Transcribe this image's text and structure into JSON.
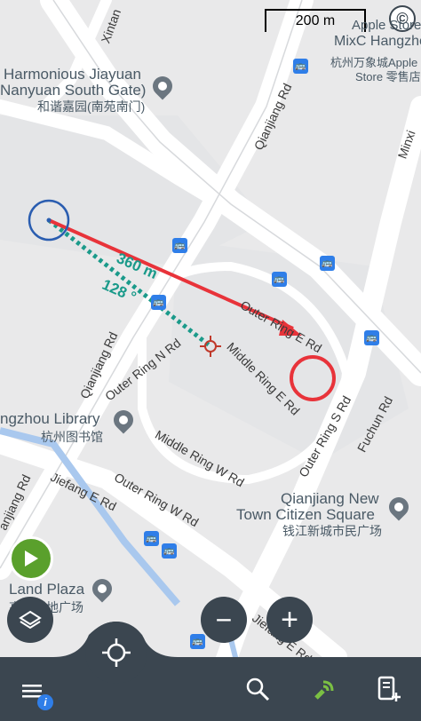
{
  "scale": {
    "label": "200 m"
  },
  "copyright_icon": "copyright-icon",
  "measurement": {
    "distance": "360 m",
    "bearing": "128 °"
  },
  "pois": {
    "apple_store": {
      "line1": "Apple Store, th",
      "line2": "MixC Hangzhou",
      "line3": "杭州万象城Apple",
      "line4": "Store 零售店"
    },
    "harmonious": {
      "line1": "Harmonious Jiayuan",
      "line2": "Nanyuan South Gate)",
      "line3": "和谐嘉园(南苑南门)"
    },
    "library": {
      "line1": "ngzhou Library",
      "line2": "杭州图书馆"
    },
    "citizen_square": {
      "line1": "Qianjiang New",
      "line2": "Town Citizen Square",
      "line3": "钱江新城市民广场"
    },
    "land_plaza": {
      "line1": "Land Plaza",
      "line2": "高德置地广场"
    }
  },
  "roads": {
    "xintang": "Xintan",
    "qianjiang_top": "Qianjiang Rd",
    "minxin": "Minxi",
    "outer_ring_e": "Outer Ring E Rd",
    "middle_ring_e": "Middle Ring E Rd",
    "outer_ring_n": "Outer Ring N Rd",
    "qianjiang_left": "Qianjiang Rd",
    "middle_ring_w": "Middle Ring W Rd",
    "outer_ring_s": "Outer Ring S Rd",
    "fuchun": "Fuchun Rd",
    "outer_ring_w": "Outer Ring W Rd",
    "jiefang_e": "Jiefang E Rd",
    "anjiang": "anjiang Rd",
    "jiefang_e2": "Jiefang E Rd"
  },
  "buttons": {
    "zoom_out": "−",
    "zoom_in": "+"
  },
  "colors": {
    "measure_line": "#e8333a",
    "bearing_line": "#1a9a8a",
    "location_circle": "#2a5db0",
    "play_button": "#5aa02c",
    "bottom_bar": "#3b4650"
  }
}
